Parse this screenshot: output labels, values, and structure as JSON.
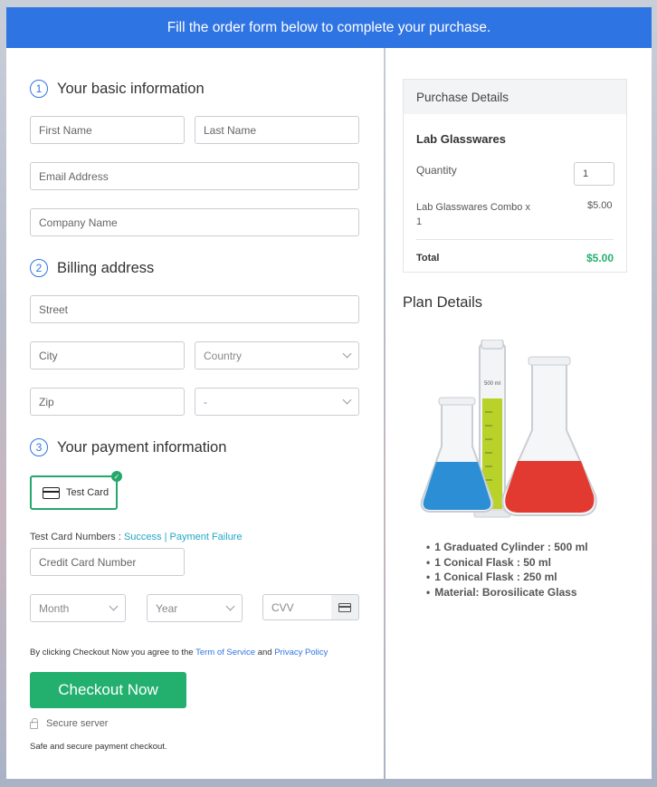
{
  "banner": {
    "text": "Fill the order form below to complete your purchase."
  },
  "form": {
    "section1": {
      "number": "1",
      "title": "Your basic information"
    },
    "first_name": "First Name",
    "last_name": "Last Name",
    "email": "Email Address",
    "company": "Company Name",
    "section2": {
      "number": "2",
      "title": "Billing address"
    },
    "street": "Street",
    "city": "City",
    "country": "Country",
    "zip": "Zip",
    "state": "-",
    "section3": {
      "number": "3",
      "title": "Your payment information"
    },
    "card_option": "Test Card",
    "test_numbers_label": "Test Card Numbers :",
    "success_link": "Success",
    "separator": "|",
    "failure_link": "Payment Failure",
    "card_number": "Credit Card Number",
    "month": "Month",
    "year": "Year",
    "cvv": "CVV",
    "terms_prefix": "By clicking Checkout Now you agree to the",
    "terms_link": "Term of Service",
    "terms_and": "and",
    "privacy_link": "Privacy Policy",
    "checkout_button": "Checkout Now",
    "secure_server": "Secure server",
    "secure_note": "Safe and secure payment checkout."
  },
  "purchase": {
    "header": "Purchase Details",
    "product": "Lab Glasswares",
    "quantity_label": "Quantity",
    "quantity_value": "1",
    "line_item": "Lab Glasswares Combo x",
    "line_item_qty": "1",
    "line_price": "$5.00",
    "total_label": "Total",
    "total_value": "$5.00"
  },
  "plan": {
    "title": "Plan Details",
    "features": [
      "1 Graduated Cylinder : 500 ml",
      "1 Conical Flask : 50 ml",
      "1 Conical Flask : 250 ml",
      "Material: Borosilicate Glass"
    ],
    "image_text": {
      "cylinder_label": "500 ml"
    }
  },
  "colors": {
    "accent": "#2f74e3",
    "success": "#23b06f",
    "link": "#22a6c6"
  }
}
